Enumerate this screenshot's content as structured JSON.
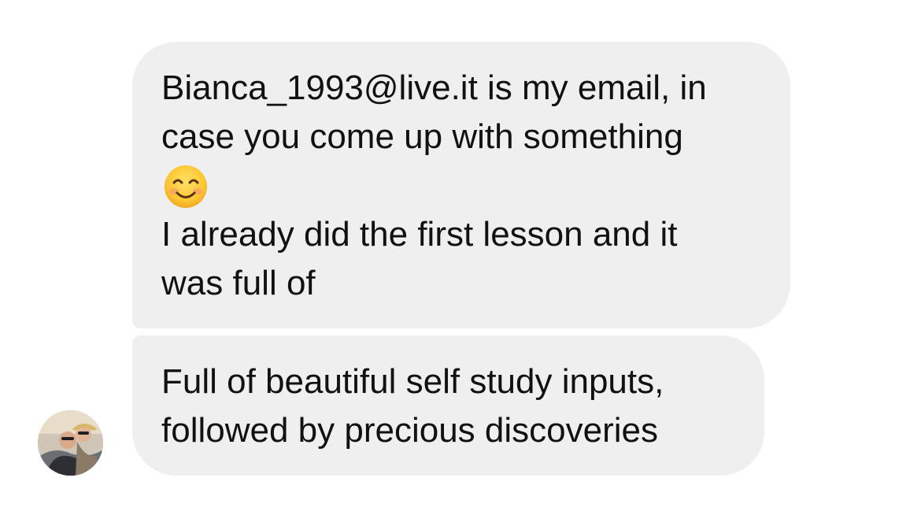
{
  "conversation": {
    "messages": [
      {
        "sender": "me",
        "lines_before_emoji": [
          "Bianca_1993@live.it is my email, in",
          "case you come up with something"
        ],
        "emoji": "smiling-face-emoji",
        "lines_after_emoji": [
          "I already did the first lesson and it",
          "was full of"
        ]
      },
      {
        "sender": "contact",
        "lines": [
          "Full of beautiful self study inputs,",
          "followed by precious discoveries"
        ]
      }
    ]
  },
  "avatar": {
    "icon": "profile-photo-avatar"
  },
  "colors": {
    "bubble_background": "#efefef",
    "text": "#111111",
    "page_background": "#ffffff"
  }
}
